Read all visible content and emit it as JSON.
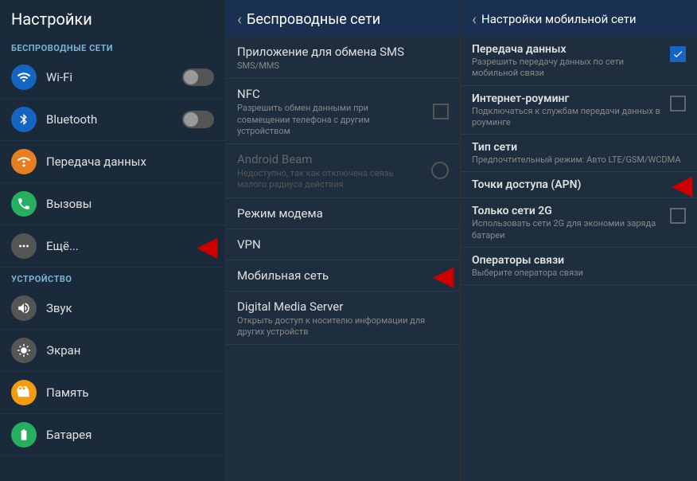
{
  "left_panel": {
    "title": "Настройки",
    "sections": [
      {
        "label": "БЕСПРОВОДНЫЕ СЕТИ",
        "items": [
          {
            "id": "wifi",
            "text": "Wi-Fi",
            "icon": "wifi",
            "has_toggle": true,
            "icon_char": "📶"
          },
          {
            "id": "bluetooth",
            "text": "Bluetooth",
            "icon": "bluetooth",
            "has_toggle": true,
            "icon_char": "🔵"
          },
          {
            "id": "data",
            "text": "Передача данных",
            "icon": "data",
            "has_toggle": false,
            "icon_char": "📊"
          },
          {
            "id": "calls",
            "text": "Вызовы",
            "icon": "calls",
            "has_toggle": false,
            "icon_char": "📞"
          },
          {
            "id": "more",
            "text": "Ещё...",
            "icon": "more",
            "has_toggle": false,
            "icon_char": "⚙",
            "has_red_arrow": true
          }
        ]
      },
      {
        "label": "УСТРОЙСТВО",
        "items": [
          {
            "id": "sound",
            "text": "Звук",
            "icon": "sound",
            "has_toggle": false,
            "icon_char": "🔊"
          },
          {
            "id": "display",
            "text": "Экран",
            "icon": "display",
            "has_toggle": false,
            "icon_char": "💡"
          },
          {
            "id": "storage",
            "text": "Память",
            "icon": "storage",
            "has_toggle": false,
            "icon_char": "💾"
          },
          {
            "id": "battery",
            "text": "Батарея",
            "icon": "battery",
            "has_toggle": false,
            "icon_char": "🔋"
          }
        ]
      }
    ]
  },
  "middle_panel": {
    "title": "Беспроводные сети",
    "items": [
      {
        "id": "sms",
        "title": "Приложение для обмена SMS",
        "subtitle": "SMS/MMS",
        "type": "normal"
      },
      {
        "id": "nfc",
        "title": "NFC",
        "subtitle": "Разрешить обмен данными при совмещении телефона с другим устройством",
        "type": "checkbox"
      },
      {
        "id": "android_beam",
        "title": "Android Beam",
        "subtitle": "Недоступно, так как отключена связь малого радиуса действия",
        "type": "circle_disabled"
      },
      {
        "id": "modem",
        "title": "Режим модема",
        "subtitle": "",
        "type": "normal"
      },
      {
        "id": "vpn",
        "title": "VPN",
        "subtitle": "",
        "type": "normal"
      },
      {
        "id": "mobile_net",
        "title": "Мобильная сеть",
        "subtitle": "",
        "type": "normal",
        "has_red_arrow": true
      },
      {
        "id": "dms",
        "title": "Digital Media Server",
        "subtitle": "Открыть доступ к носителю информации для других устройств",
        "type": "normal"
      }
    ]
  },
  "right_panel": {
    "title": "Настройки мобильной сети",
    "items": [
      {
        "id": "data_transfer",
        "title": "Передача данных",
        "subtitle": "Разрешить передачу данных по сети мобильной связи",
        "type": "checkbox_checked"
      },
      {
        "id": "roaming",
        "title": "Интернет-роуминг",
        "subtitle": "Подключаться к службам передачи данных в роуминге",
        "type": "checkbox_empty"
      },
      {
        "id": "network_type",
        "title": "Тип сети",
        "subtitle": "Предпочтительный режим: Авто LTE/GSM/WCDMA",
        "type": "normal"
      },
      {
        "id": "apn",
        "title": "Точки доступа (APN)",
        "subtitle": "",
        "type": "normal",
        "has_red_arrow": true
      },
      {
        "id": "2g_only",
        "title": "Только сети 2G",
        "subtitle": "Использовать сети 2G для экономии заряда батареи",
        "type": "checkbox_empty"
      },
      {
        "id": "operators",
        "title": "Операторы связи",
        "subtitle": "Выберите оператора связи",
        "type": "normal"
      }
    ]
  },
  "icons": {
    "wifi": "⊙",
    "bluetooth": "ℬ",
    "data": "◑",
    "calls": "✆",
    "more": "⊕",
    "sound": "♪",
    "display": "☀",
    "storage": "⬜",
    "battery": "⚡"
  }
}
